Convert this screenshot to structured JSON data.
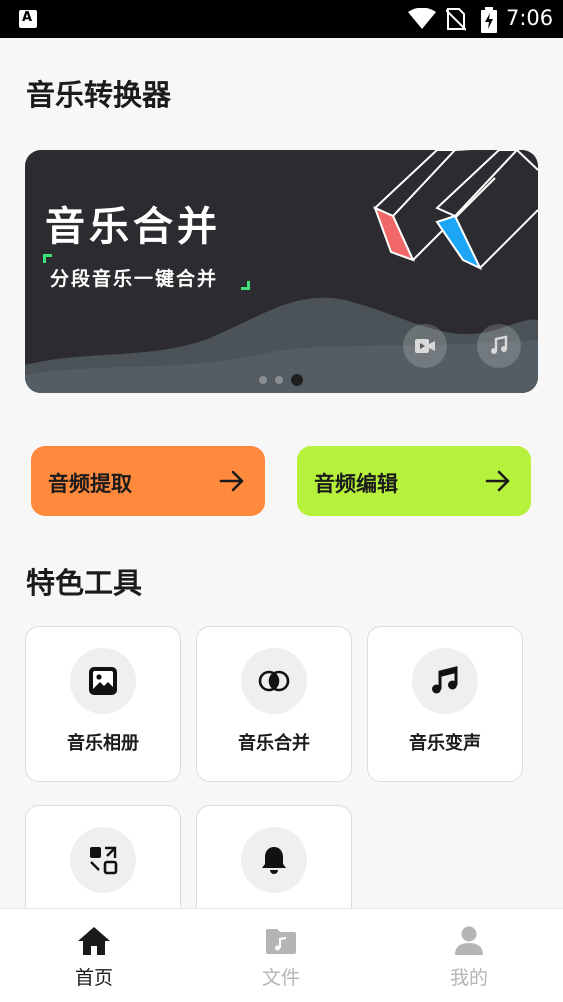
{
  "status_bar": {
    "app_icon_letter": "A",
    "time": "7:06",
    "icons": [
      "wifi-icon",
      "no-sim-icon",
      "battery-charging-icon"
    ]
  },
  "page": {
    "title": "音乐转换器"
  },
  "banner": {
    "title": "音乐合并",
    "subtitle": "分段音乐一键合并",
    "buttons": [
      "video-icon",
      "music-note-icon"
    ],
    "dots_total": 3,
    "dots_active_index": 2,
    "colors": {
      "background": "#2c2c30",
      "wave": "#4b5358",
      "accent_green": "#3ee07a",
      "prism_red": "#f26767",
      "prism_blue": "#1da6f5"
    }
  },
  "quick_actions": [
    {
      "label": "音频提取",
      "color": "#ff8a3d",
      "icon": "arrow-right-icon"
    },
    {
      "label": "音频编辑",
      "color": "#b6f23b",
      "icon": "arrow-right-icon"
    }
  ],
  "tools_section": {
    "title": "特色工具",
    "tools": [
      {
        "label": "音乐相册",
        "icon": "image-icon"
      },
      {
        "label": "音乐合并",
        "icon": "merge-circles-icon"
      },
      {
        "label": "音乐变声",
        "icon": "music-note-icon"
      },
      {
        "label": "",
        "icon": "format-convert-icon"
      },
      {
        "label": "",
        "icon": "bell-icon"
      }
    ]
  },
  "bottom_nav": {
    "items": [
      {
        "label": "首页",
        "icon": "home-icon",
        "active": true
      },
      {
        "label": "文件",
        "icon": "music-folder-icon",
        "active": false
      },
      {
        "label": "我的",
        "icon": "user-icon",
        "active": false
      }
    ],
    "active_color": "#1b1b1b",
    "inactive_color": "#b5b5b5"
  }
}
